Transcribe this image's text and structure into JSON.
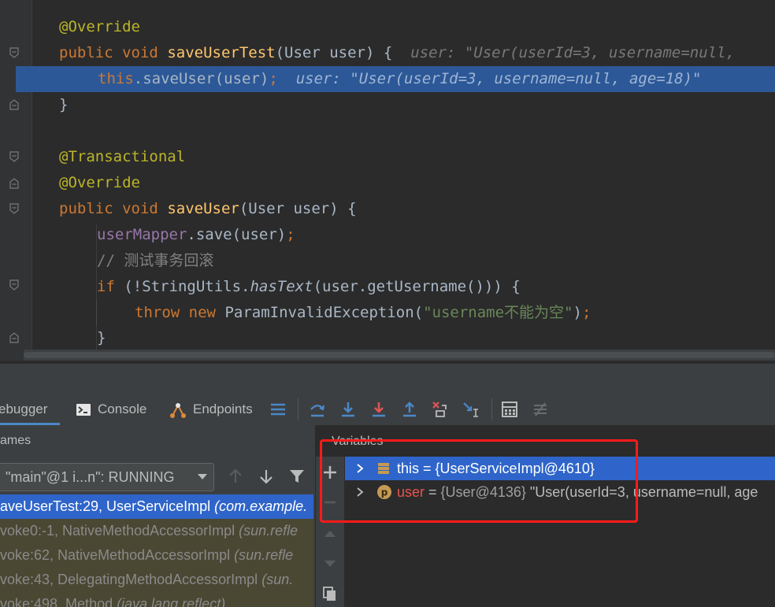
{
  "editor": {
    "lines": {
      "l1": {
        "ann": "@Override"
      },
      "l2": {
        "kw1": "public",
        "kw2": "void",
        "fn": "saveUserTest",
        "params": "(User user) {",
        "inlay": "user: \"User(userId=3, username=null, "
      },
      "l3": {
        "kw": "this",
        "call": ".saveUser(user)",
        "semi": ";",
        "inlay": "user: \"User(userId=3, username=null, age=18)\""
      },
      "l4": {
        "text": "}"
      },
      "l6": {
        "ann": "@Transactional"
      },
      "l7": {
        "ann": "@Override"
      },
      "l8": {
        "kw1": "public",
        "kw2": "void",
        "fn": "saveUser",
        "params": "(User user) {"
      },
      "l9": {
        "field": "userMapper",
        "call": ".save(user)",
        "semi": ";"
      },
      "l10": {
        "comment": "// 测试事务回滚"
      },
      "l11": {
        "kw": "if",
        "pre": " (!StringUtils.",
        "method": "hasText",
        "post": "(user.getUsername())) {"
      },
      "l12": {
        "kw1": "throw",
        "kw2": "new",
        "cls": "ParamInvalidException(",
        "str": "\"username不能为空\"",
        "end": ")",
        "semi": ";"
      },
      "l13": {
        "text": "}"
      }
    }
  },
  "debugger": {
    "tabs": {
      "debugger": "ebugger",
      "console": "Console",
      "endpoints": "Endpoints"
    },
    "frames_title": "ames",
    "thread": "\"main\"@1 i...n\": RUNNING",
    "frames": [
      {
        "method": "aveUserTest:29, UserServiceImpl",
        "pkg": "(com.example."
      },
      {
        "method": "voke0:-1, NativeMethodAccessorImpl",
        "pkg": "(sun.refle"
      },
      {
        "method": "voke:62, NativeMethodAccessorImpl",
        "pkg": "(sun.refle"
      },
      {
        "method": "voke:43, DelegatingMethodAccessorImpl",
        "pkg": "(sun."
      },
      {
        "method": "voke:498, Method",
        "pkg": "(java.lang.reflect)"
      }
    ],
    "variables_title": "Variables",
    "variables": [
      {
        "name": "this",
        "eq": " = ",
        "value": "{UserServiceImpl@4610}",
        "tail": ""
      },
      {
        "name": "user",
        "eq": " = ",
        "value": "{User@4136}",
        "tail": " \"User(userId=3, username=null, age"
      }
    ]
  },
  "colors": {
    "accent": "#2f65ca",
    "highlight_box": "#ff1a1a",
    "editor_bg": "#2b2b2b"
  }
}
